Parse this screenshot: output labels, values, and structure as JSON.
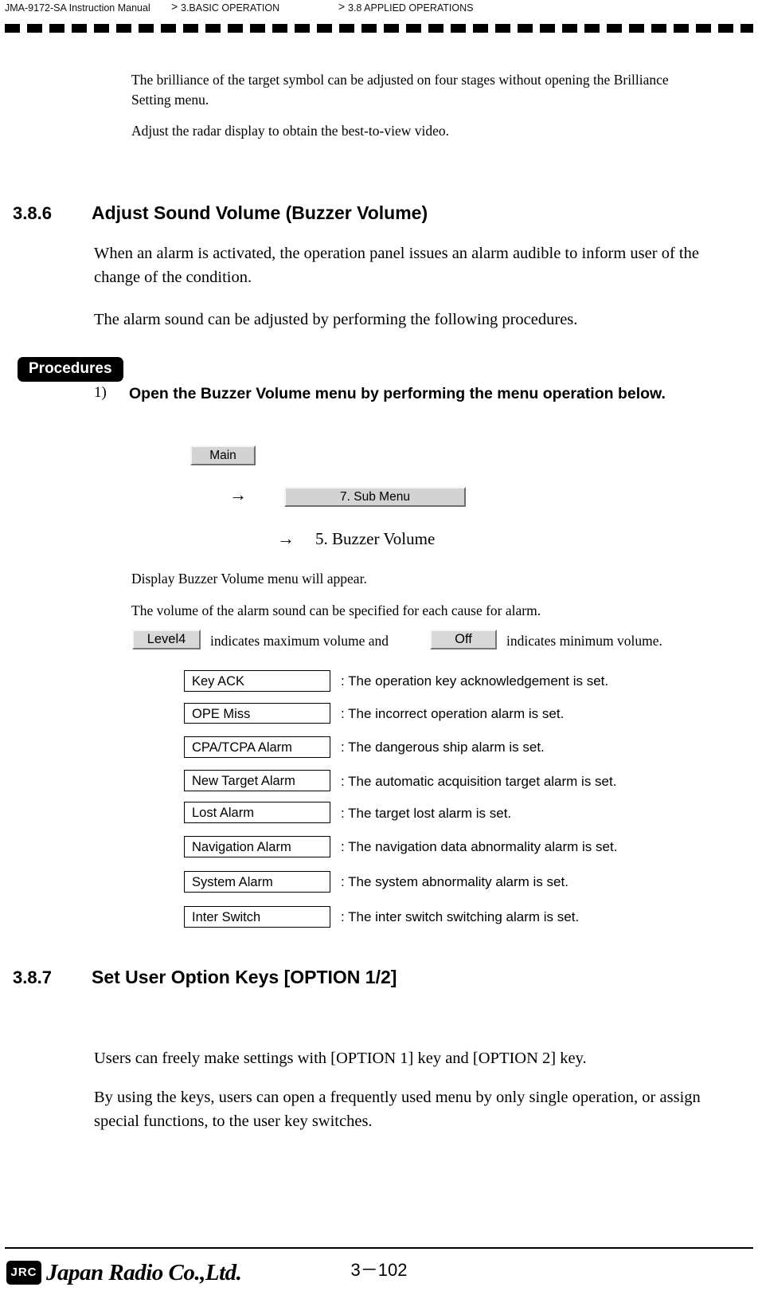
{
  "header": {
    "manual": "JMA-9172-SA Instruction Manual",
    "sep1": ">",
    "chapter": "3.BASIC OPERATION",
    "sep2": ">",
    "section": "3.8  APPLIED OPERATIONS"
  },
  "intro": {
    "p1": "The brilliance of the target symbol can be adjusted on four stages without opening the Brilliance Setting menu.",
    "p2": "Adjust the radar display to obtain the best-to-view video."
  },
  "section_386": {
    "number": "3.8.6",
    "title": "Adjust Sound Volume (Buzzer Volume)",
    "p1": "When an alarm is activated, the operation panel issues an alarm audible to inform user of the change of the condition.",
    "p2": "The alarm sound can be adjusted by performing the following procedures.",
    "procedures_label": "Procedures",
    "step1_num": "1)",
    "step1_text": "Open the Buzzer Volume menu by performing the menu operation below.",
    "key_main": "Main",
    "arrow1": "→",
    "key_submenu": "7. Sub Menu",
    "arrow2": "→",
    "key_buzzer": "5. Buzzer Volume",
    "p3": "Display Buzzer Volume menu will appear.",
    "p4": "The volume of the alarm sound can be specified for each cause for alarm.",
    "vol_max_key": "Level4",
    "vol_max_text": "indicates maximum volume and",
    "vol_min_key": "Off",
    "vol_min_text": "indicates minimum volume.",
    "alarms": [
      {
        "key": "Key ACK",
        "desc": ": The operation key acknowledgement is set."
      },
      {
        "key": "OPE Miss",
        "desc": ": The incorrect operation alarm is set."
      },
      {
        "key": "CPA/TCPA Alarm",
        "desc": ": The dangerous ship alarm is set."
      },
      {
        "key": "New Target Alarm",
        "desc": ": The automatic acquisition target alarm is set."
      },
      {
        "key": "Lost Alarm",
        "desc": ": The target lost alarm is set."
      },
      {
        "key": "Navigation Alarm",
        "desc": ": The navigation data abnormality alarm is set."
      },
      {
        "key": "System Alarm",
        "desc": ": The system abnormality alarm is set."
      },
      {
        "key": "Inter Switch",
        "desc": ": The inter switch switching alarm is set."
      }
    ]
  },
  "section_387": {
    "number": "3.8.7",
    "title": "Set User Option Keys [OPTION 1/2]",
    "p1": "Users can freely make settings with [OPTION 1] key and [OPTION 2] key.",
    "p2": "By using the keys, users can open a frequently used menu by only single operation, or assign special functions, to the user key switches."
  },
  "footer": {
    "logo": "JRC",
    "company": "Japan Radio Co.,Ltd.",
    "page": "3－102"
  }
}
